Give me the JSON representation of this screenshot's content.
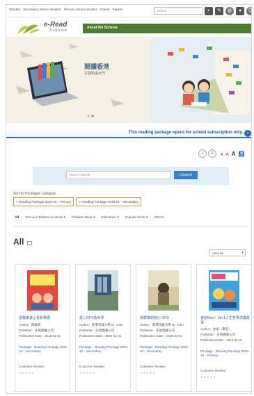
{
  "top_links": [
    "Teacher",
    "Secondary School Student",
    "Primary School Student",
    "Parent",
    "Partner"
  ],
  "search": {
    "placeholder": "Search"
  },
  "logo": {
    "title": "e-Read",
    "subtitle": "Scheme"
  },
  "header": {
    "about_label": "About the Scheme"
  },
  "banner": {
    "title": "閱讀香港",
    "subtitle": "打開知識大門"
  },
  "subscription_notice": "This reading package opens for school subscription only.",
  "pager": [
    "1",
    "2"
  ],
  "font_sizes": [
    "A",
    "A",
    "A"
  ],
  "ebook_search": {
    "placeholder": "Search eBook",
    "button": "Search"
  },
  "category": {
    "label": "Sort by Packages Category:",
    "chips": [
      "Reading Package 2015-16 – Primary",
      "Reading Package 2015-16 – Secondary"
    ]
  },
  "filters": [
    "All",
    "Text and Reference Book",
    "Children Book",
    "Education",
    "Popular Book",
    "Others"
  ],
  "all_heading": "All",
  "view_by": "View by",
  "books": [
    {
      "title": "從醫孝勇士看新數碼",
      "author": "Author：邵敏明",
      "publisher": "Publisher：天地圖書公司",
      "pub_date": "Publication Date：2015-01-01",
      "package": "Package：Reading Package 2015-16 – Secondary",
      "review_label": "Customer Review：",
      "stars": "★★★★★"
    },
    {
      "title": "從心GPS看世界",
      "author": "Author：香港浸會大學 Dr. John",
      "publisher": "Publisher：天地圖書公司",
      "pub_date": "Publication Date：2015-01-01",
      "package": "Package：Reading Package 2015-16 – Secondary",
      "review_label": "Customer Review：",
      "stars": "★★★★★"
    },
    {
      "title": "我要做的信心 GPS",
      "author": "Author：香港浸會大學 Dr. John",
      "publisher": "Publisher：天地圖書公司",
      "pub_date": "Publication Date：2015-01-01",
      "package": "Package：Reading Package 2015-16 – Secondary",
      "review_label": "Customer Review：",
      "stars": "★★★★★"
    },
    {
      "title": "書語Man！Vol 1人生哲學漫畫故事",
      "author": "Author：沈斌（筆名）",
      "publisher": "Publisher：天地圖書公司",
      "pub_date": "Publication Date：2015-01-01",
      "package": "Package：Reading Package 2015-16 – Primary",
      "review_label": "Customer Review：",
      "stars": "★★★★★"
    }
  ],
  "colors": {
    "green": "#4f7d2f",
    "blue": "#2d6ea8",
    "orange": "#e08e3a"
  }
}
